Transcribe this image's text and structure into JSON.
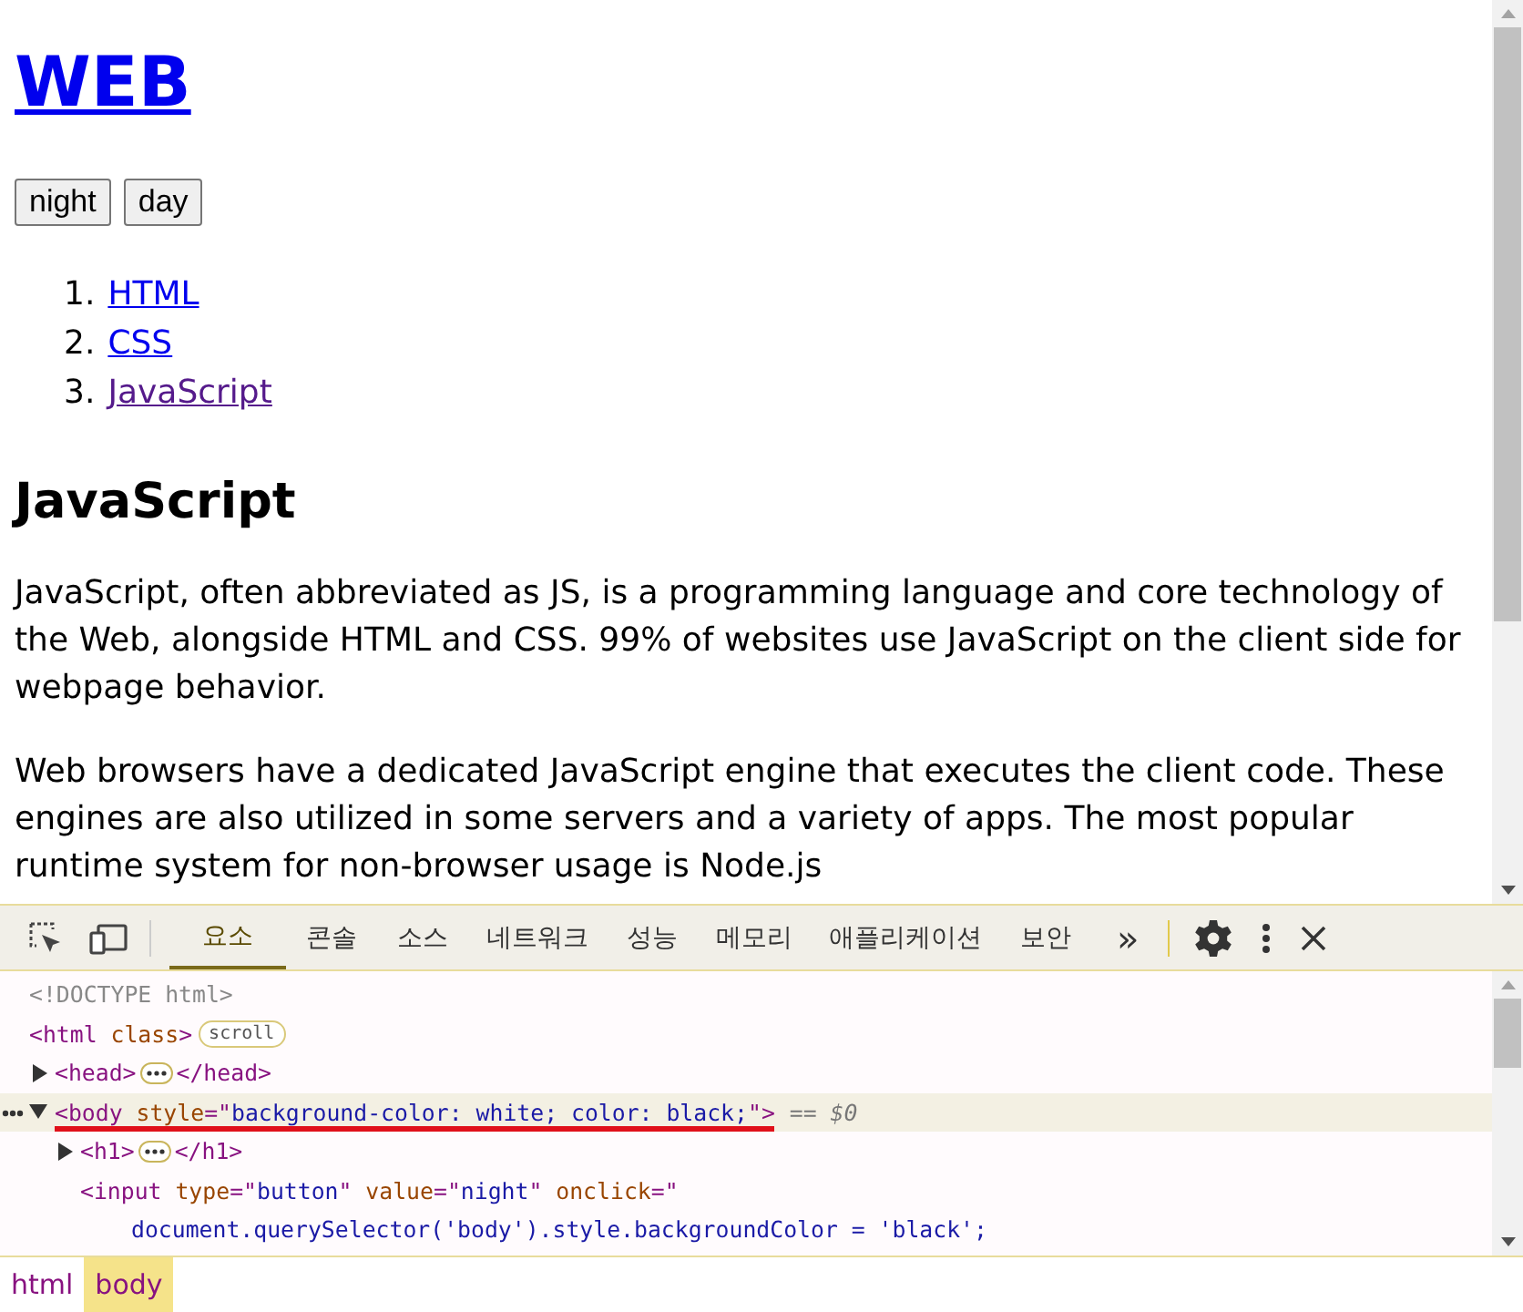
{
  "page": {
    "heading": "WEB",
    "buttons": [
      "night",
      "day"
    ],
    "links": [
      {
        "number": "1.",
        "label": "HTML",
        "visited": false
      },
      {
        "number": "2.",
        "label": "CSS",
        "visited": false
      },
      {
        "number": "3.",
        "label": "JavaScript",
        "visited": true
      }
    ],
    "title": "JavaScript",
    "paragraphs": [
      "JavaScript, often abbreviated as JS, is a programming language and core technology of the Web, alongside HTML and CSS. 99% of websites use JavaScript on the client side for webpage behavior.",
      "Web browsers have a dedicated JavaScript engine that executes the client code. These engines are also utilized in some servers and a variety of apps. The most popular runtime system for non-browser usage is Node.js"
    ]
  },
  "devtools": {
    "tabs": [
      {
        "label": "요소",
        "selected": true
      },
      {
        "label": "콘솔",
        "selected": false
      },
      {
        "label": "소스",
        "selected": false
      },
      {
        "label": "네트워크",
        "selected": false
      },
      {
        "label": "성능",
        "selected": false
      },
      {
        "label": "메모리",
        "selected": false
      },
      {
        "label": "애플리케이션",
        "selected": false
      },
      {
        "label": "보안",
        "selected": false
      }
    ],
    "more": "»",
    "dom": [
      {
        "tokens": [
          {
            "kind": "doctype",
            "s": "<!DOCTYPE html>"
          }
        ]
      },
      {
        "tokens": [
          {
            "kind": "tag",
            "s": "<html "
          },
          {
            "kind": "attr",
            "s": "class"
          },
          {
            "kind": "tag",
            "s": ">"
          }
        ],
        "badge": "scroll",
        "children": [
          {
            "tokens": [
              {
                "kind": "tag",
                "s": "<head>"
              }
            ],
            "collapsed_end": "</head>",
            "expanded": false
          },
          {
            "tokens": [
              {
                "kind": "tag",
                "s": "<body "
              },
              {
                "kind": "attr",
                "s": "style"
              },
              {
                "kind": "tag",
                "s": "=\""
              },
              {
                "kind": "value",
                "s": "background-color: white; color: black;"
              },
              {
                "kind": "tag",
                "s": "\">"
              }
            ],
            "expanded": true,
            "selected": true,
            "underlined": true,
            "marker": "== $0",
            "children": [
              {
                "tokens": [
                  {
                    "kind": "tag",
                    "s": "<h1>"
                  }
                ],
                "collapsed_end": "</h1>",
                "expanded": false
              },
              {
                "tokens": [
                  {
                    "kind": "tag",
                    "s": "<input "
                  },
                  {
                    "kind": "attr",
                    "s": "type"
                  },
                  {
                    "kind": "tag",
                    "s": "=\""
                  },
                  {
                    "kind": "value",
                    "s": "button"
                  },
                  {
                    "kind": "tag",
                    "s": "\" "
                  },
                  {
                    "kind": "attr",
                    "s": "value"
                  },
                  {
                    "kind": "tag",
                    "s": "=\""
                  },
                  {
                    "kind": "value",
                    "s": "night"
                  },
                  {
                    "kind": "tag",
                    "s": "\" "
                  },
                  {
                    "kind": "attr",
                    "s": "onclick"
                  },
                  {
                    "kind": "tag",
                    "s": "=\""
                  }
                ],
                "continuation": "document.querySelector('body').style.backgroundColor = 'black';"
              }
            ]
          }
        ]
      }
    ],
    "breadcrumbs": [
      {
        "label": "html",
        "selected": false
      },
      {
        "label": "body",
        "selected": true
      }
    ]
  }
}
